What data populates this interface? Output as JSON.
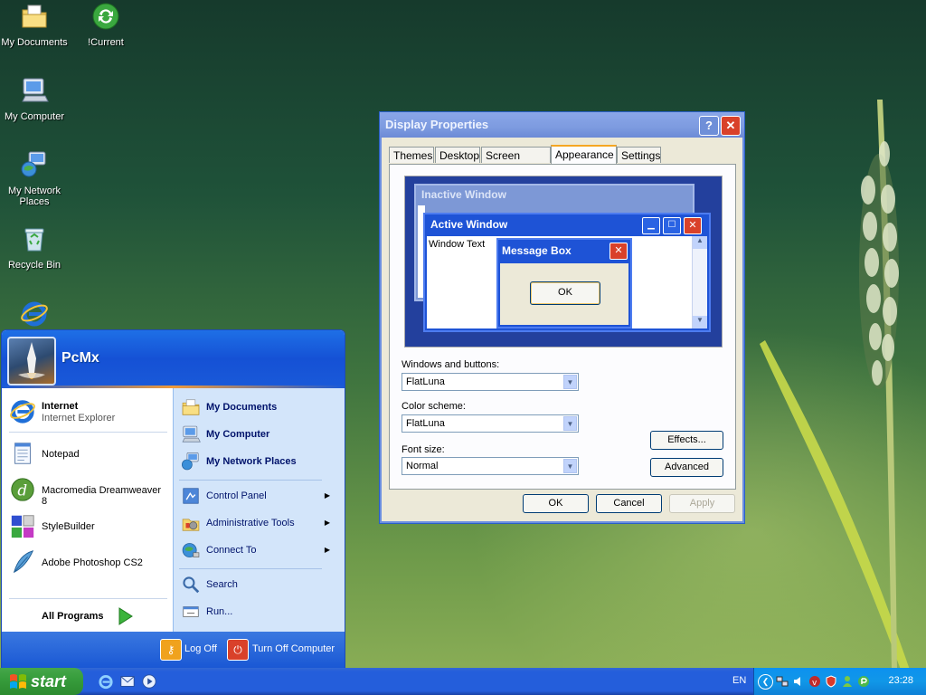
{
  "desktop": {
    "icons": [
      {
        "label": "My Documents",
        "icon": "my-documents-icon"
      },
      {
        "label": "!Current",
        "icon": "recycle-arrows-icon"
      },
      {
        "label": "My Computer",
        "icon": "my-computer-icon"
      },
      {
        "label": "My Network Places",
        "icon": "network-places-icon"
      },
      {
        "label": "Recycle Bin",
        "icon": "recycle-bin-icon"
      },
      {
        "label": "",
        "icon": "internet-explorer-icon"
      }
    ]
  },
  "dialog": {
    "title": "Display Properties",
    "help_label": "?",
    "close_label": "✕",
    "tabs": [
      {
        "label": "Themes"
      },
      {
        "label": "Desktop"
      },
      {
        "label": "Screen Saver"
      },
      {
        "label": "Appearance",
        "active": true
      },
      {
        "label": "Settings"
      }
    ],
    "preview": {
      "inactive_title": "Inactive Window",
      "active_title": "Active Window",
      "window_text": "Window Text",
      "message_title": "Message Box",
      "ok_label": "OK"
    },
    "windows_buttons_label": "Windows and buttons:",
    "windows_buttons_value": "FlatLuna",
    "color_scheme_label": "Color scheme:",
    "color_scheme_value": "FlatLuna",
    "font_size_label": "Font size:",
    "font_size_value": "Normal",
    "effects_label": "Effects...",
    "advanced_label": "Advanced",
    "ok_label": "OK",
    "cancel_label": "Cancel",
    "apply_label": "Apply"
  },
  "start_menu": {
    "user": "PcMx",
    "pinned": [
      {
        "title": "Internet",
        "subtitle": "Internet Explorer"
      }
    ],
    "recent": [
      {
        "label": "Notepad"
      },
      {
        "label": "Macromedia Dreamweaver 8"
      },
      {
        "label": "StyleBuilder"
      },
      {
        "label": "Adobe Photoshop CS2"
      }
    ],
    "all_programs": "All Programs",
    "right": [
      {
        "label": "My Documents",
        "bold": true
      },
      {
        "label": "My Computer",
        "bold": true
      },
      {
        "label": "My Network Places",
        "bold": true
      },
      {
        "label": "Control Panel"
      },
      {
        "label": "Administrative Tools"
      },
      {
        "label": "Connect To"
      },
      {
        "label": "Search"
      },
      {
        "label": "Run..."
      }
    ],
    "log_off": "Log Off",
    "turn_off": "Turn Off Computer"
  },
  "taskbar": {
    "start_label": "start",
    "language": "EN",
    "clock": "23:28"
  },
  "colors": {
    "taskbar_blue": "#245edb",
    "start_green": "#379d3c",
    "dialog_bg": "#ece9d8",
    "close_red": "#d9412a"
  }
}
